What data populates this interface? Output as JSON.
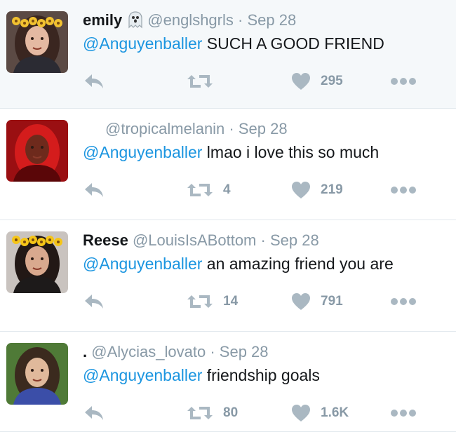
{
  "tweets": [
    {
      "name": "emily",
      "has_ghost_emoji": true,
      "handle": "@englshgrls",
      "separator": "·",
      "date": "Sep 28",
      "mention": "@Anguyenballer",
      "text": " SUCH A GOOD FRIEND",
      "retweets": "",
      "likes": "295",
      "highlighted": true,
      "avatar": {
        "bg": "#5b4a44",
        "hair": "#3a2620",
        "skin": "#e4b9a2",
        "accent": "#f2c230",
        "shirt": "#2b2b33"
      }
    },
    {
      "name": "",
      "has_ghost_emoji": false,
      "handle": "@tropicalmelanin",
      "separator": "·",
      "date": "Sep 28",
      "mention": "@Anguyenballer",
      "text": " lmao i love this so much",
      "retweets": "4",
      "likes": "219",
      "highlighted": false,
      "avatar": {
        "bg": "#9a0f12",
        "hair": "#d41c1c",
        "skin": "#6e2a1c",
        "accent": "#ff3a2a",
        "shirt": "#5a0608"
      }
    },
    {
      "name": "Reese",
      "has_ghost_emoji": false,
      "handle": "@LouisIsABottom",
      "separator": "·",
      "date": "Sep 28",
      "mention": "@Anguyenballer",
      "text": " an amazing friend you are",
      "retweets": "14",
      "likes": "791",
      "highlighted": false,
      "avatar": {
        "bg": "#c9c3bf",
        "hair": "#221815",
        "skin": "#d9a98e",
        "accent": "#f5c518",
        "shirt": "#1d1a1a"
      }
    },
    {
      "name": ".",
      "has_ghost_emoji": false,
      "handle": "@Alycias_lovato",
      "separator": "·",
      "date": "Sep 28",
      "mention": "@Anguyenballer",
      "text": " friendship goals",
      "retweets": "80",
      "likes": "1.6K",
      "highlighted": false,
      "avatar": {
        "bg": "#4f7a37",
        "hair": "#3b2a1e",
        "skin": "#e0b99b",
        "accent": "#8fb55a",
        "shirt": "#3b4ea8"
      }
    }
  ],
  "colors": {
    "icon_gray": "#aab8c2",
    "link_blue": "#1b95e0",
    "meta_gray": "#8899a6",
    "highlight_bg": "#f5f8fa"
  },
  "icons": {
    "reply": "reply-icon",
    "retweet": "retweet-icon",
    "like": "heart-icon",
    "more": "more-icon"
  }
}
